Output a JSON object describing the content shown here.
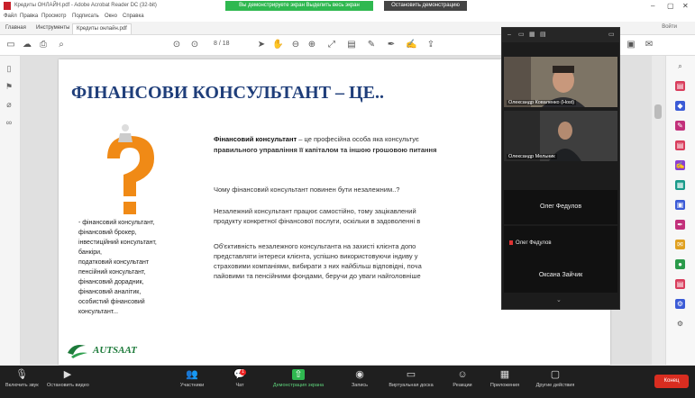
{
  "window": {
    "title": "Кредиты ОНЛАЙН.pdf - Adobe Acrobat Reader DC (32-bit)",
    "share_banner": "Вы демонстрируете экран Выделить весь экран",
    "stop_share": "Остановить демонстрацию"
  },
  "menu": [
    "Файл",
    "Правка",
    "Просмотр",
    "Подписать",
    "Окно",
    "Справка"
  ],
  "tabs": [
    "Главная",
    "Инструменты",
    "Кредиты онлайн.pdf"
  ],
  "signin": "Войти",
  "toolbar": {
    "page_current": "8",
    "page_total": "/ 18"
  },
  "slide": {
    "title": "ФІНАНСОВИ КОНСУЛЬТАНТ – ЦЕ..",
    "person_list": [
      "- фінансовий консультант,",
      "фінансовий брокер,",
      "інвестиційний консультант,",
      "банкіри,",
      "податковий консультант",
      "пенсійний консультант,",
      "фінансовий дорадник,",
      "фінансовий аналітик,",
      "особистий фінансовий",
      "консультант..."
    ],
    "para1_bold": "Фінансовий консультант",
    "para1_rest": " – це професійна особа яка консультує",
    "para1_line2": "правильного управління її капіталом та іншою грошовою питання",
    "para2": "Чому фінансовий консультант повинен бути незалежним..?",
    "para3_l1": "Незалежний консультант працює самостійно, тому зацікавлений",
    "para3_l2": "продукту конкретної фінансової послуги, оскільки в задоволенні в",
    "para4_l1": "Об'єктивність незалежного консультанта на захисті клієнта допо",
    "para4_l2": "представляти інтереси клієнта, успішно використовуючи індиву у",
    "para4_l3": "страховими компаніями, вибирати з них найбільш відповідні, поча",
    "para4_l4": "пайовими та пенсійними фондами, беручи до уваги найголовніше",
    "logo_text": "AUTSAAT"
  },
  "video": {
    "tile1_name": "Олександр Коваленко (Host)",
    "tile2_name": "Олександр Мельник",
    "participant1": "Олег Федулов",
    "participant2": "Олег Федулов",
    "participant3": "Оксана Зайчик"
  },
  "zoom_bar": [
    {
      "label": "Включить звук",
      "icon": "mic-icon"
    },
    {
      "label": "Остановить видео",
      "icon": "camera-icon"
    },
    {
      "label": "Участники",
      "icon": "people-icon"
    },
    {
      "label": "Чат",
      "icon": "chat-icon"
    },
    {
      "label": "Демонстрация экрана",
      "icon": "share-icon"
    },
    {
      "label": "Запись",
      "icon": "record-icon"
    },
    {
      "label": "Виртуальная доска",
      "icon": "whiteboard-icon"
    },
    {
      "label": "Реакции",
      "icon": "reaction-icon"
    },
    {
      "label": "Приложения",
      "icon": "apps-icon"
    },
    {
      "label": "Другие действия",
      "icon": "more-icon"
    }
  ],
  "chat_badge": "1",
  "end_label": "Конец",
  "colors": {
    "title_blue": "#1f3e7a",
    "zoom_green": "#2fb850",
    "end_red": "#d92d20"
  }
}
